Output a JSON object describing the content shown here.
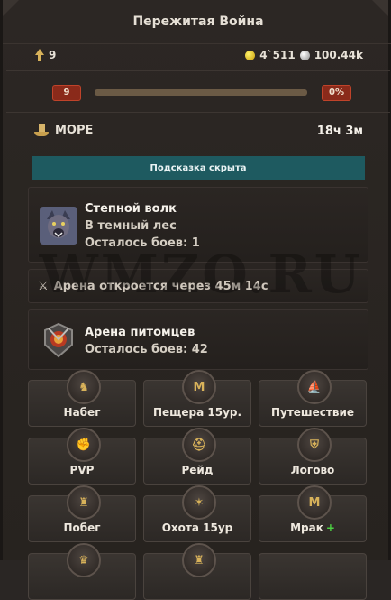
{
  "title": "Пережитая Война",
  "resources": {
    "level": "9",
    "gold": "4`511",
    "silver": "100.44k"
  },
  "xp": {
    "level_badge": "9",
    "percent_label": "0%",
    "progress": 0
  },
  "location": {
    "name": "МОРЕ",
    "timer": "18ч 3м"
  },
  "hint": "Подсказка скрыта",
  "quest": {
    "name": "Степной волк",
    "destination": "В темный лес",
    "battles_left": "Осталось боев: 1"
  },
  "arena_notice": "Арена откроется через 45м 14с",
  "pet_arena": {
    "name": "Арена питомцев",
    "battles_left": "Осталось боев: 42"
  },
  "watermark": "WMZO.RU",
  "actions": [
    {
      "label": "Набег",
      "icon": "knight-icon"
    },
    {
      "label": "Пещера 15ур.",
      "icon": "cave-icon"
    },
    {
      "label": "Путешествие",
      "icon": "ship-icon"
    },
    {
      "label": "PVP",
      "icon": "fist-icon"
    },
    {
      "label": "Рейд",
      "icon": "helmet-icon"
    },
    {
      "label": "Логово",
      "icon": "shield-icon"
    },
    {
      "label": "Побег",
      "icon": "armor-icon"
    },
    {
      "label": "Охота 15ур",
      "icon": "hunt-icon"
    },
    {
      "label": "Мрак",
      "icon": "darkness-icon",
      "plus": "+"
    }
  ],
  "colors": {
    "background": "#2a2624",
    "accent_gold": "#d8b25a",
    "hint_bg": "#1e5a60",
    "badge_red": "#8a2a1a"
  }
}
